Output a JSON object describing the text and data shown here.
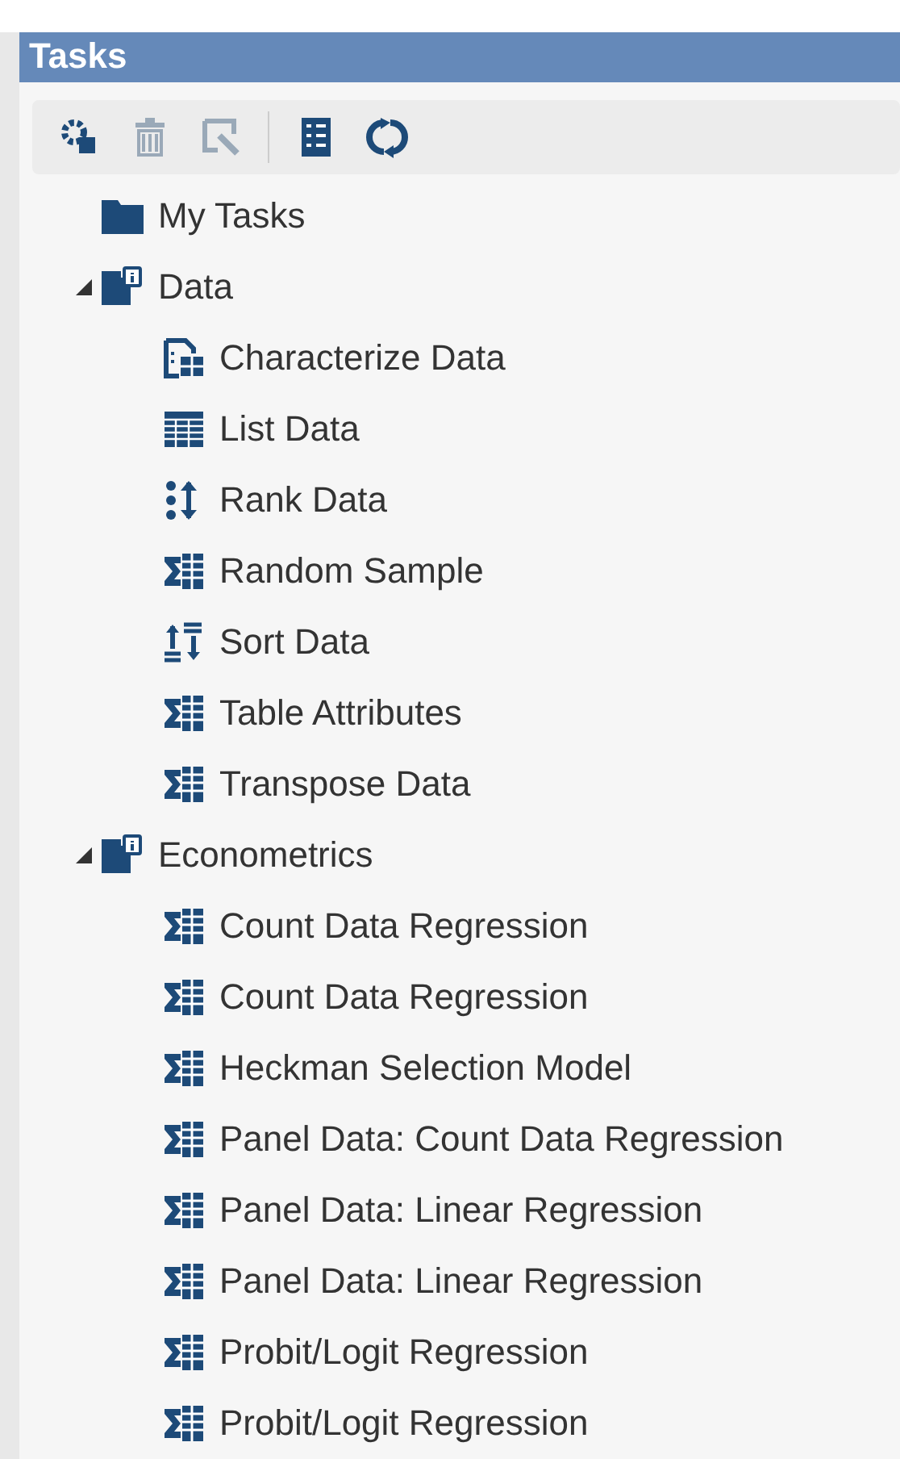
{
  "panel": {
    "title": "Tasks"
  },
  "toolbar": [
    {
      "kind": "new-task",
      "disabled": false
    },
    {
      "kind": "delete",
      "disabled": true
    },
    {
      "kind": "edit",
      "disabled": true
    },
    {
      "kind": "list",
      "disabled": false
    },
    {
      "kind": "refresh",
      "disabled": false
    }
  ],
  "tree": [
    {
      "label": "My Tasks",
      "kind": "folder"
    },
    {
      "label": "Data",
      "kind": "category",
      "expanded": true,
      "children": [
        {
          "label": "Characterize Data",
          "kind": "characterize"
        },
        {
          "label": "List Data",
          "kind": "table"
        },
        {
          "label": "Rank Data",
          "kind": "rank"
        },
        {
          "label": "Random Sample",
          "kind": "task"
        },
        {
          "label": "Sort Data",
          "kind": "sort"
        },
        {
          "label": "Table Attributes",
          "kind": "task"
        },
        {
          "label": "Transpose Data",
          "kind": "task"
        }
      ]
    },
    {
      "label": "Econometrics",
      "kind": "category",
      "expanded": true,
      "children": [
        {
          "label": "Count Data Regression",
          "kind": "task"
        },
        {
          "label": "Count Data Regression",
          "kind": "task"
        },
        {
          "label": "Heckman Selection Model",
          "kind": "task"
        },
        {
          "label": "Panel Data: Count Data Regression",
          "kind": "task"
        },
        {
          "label": "Panel Data: Linear Regression",
          "kind": "task"
        },
        {
          "label": "Panel Data: Linear Regression",
          "kind": "task"
        },
        {
          "label": "Probit/Logit Regression",
          "kind": "task"
        },
        {
          "label": "Probit/Logit Regression",
          "kind": "task"
        }
      ]
    }
  ]
}
